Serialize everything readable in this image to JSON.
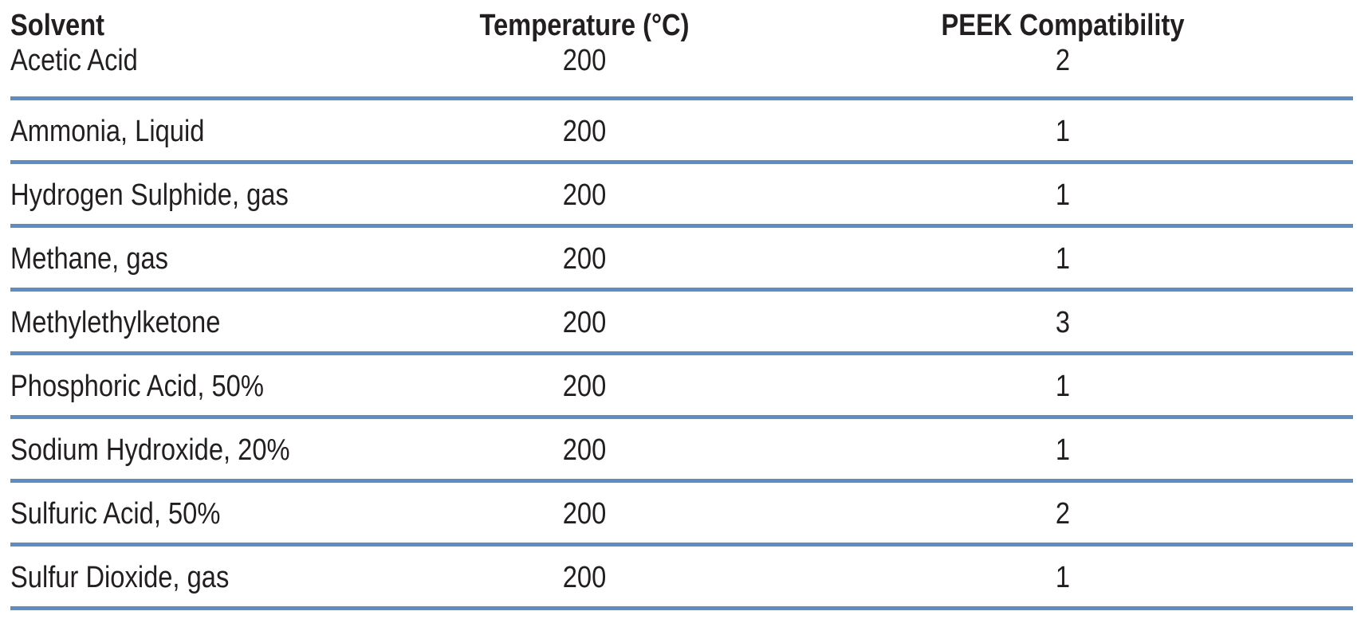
{
  "table": {
    "headers": [
      "Solvent",
      "Temperature (°C)",
      "PEEK Compatibility"
    ],
    "rows": [
      [
        "Acetic Acid",
        "200",
        "2"
      ],
      [
        "Ammonia, Liquid",
        "200",
        "1"
      ],
      [
        "Hydrogen Sulphide, gas",
        "200",
        "1"
      ],
      [
        "Methane, gas",
        "200",
        "1"
      ],
      [
        "Methylethylketone",
        "200",
        "3"
      ],
      [
        "Phosphoric Acid, 50%",
        "200",
        "1"
      ],
      [
        "Sodium Hydroxide, 20%",
        "200",
        "1"
      ],
      [
        "Sulfuric Acid, 50%",
        "200",
        "2"
      ],
      [
        "Sulfur Dioxide, gas",
        "200",
        "1"
      ]
    ],
    "rule_color": "#5b8fbe"
  }
}
